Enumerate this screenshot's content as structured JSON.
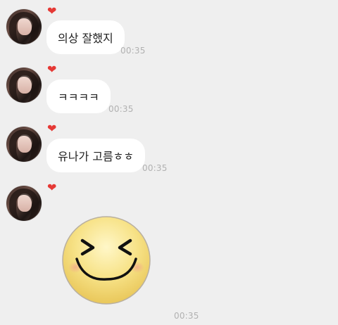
{
  "messages": [
    {
      "text": "의상 잘했지",
      "time": "00:35"
    },
    {
      "text": "ㅋㅋㅋㅋ",
      "time": "00:35"
    },
    {
      "text": "유나가 고름ㅎㅎ",
      "time": "00:35"
    },
    {
      "sticker": "smiling-laughing-emoji",
      "time": "00:35"
    }
  ],
  "reaction_icon": "heart-icon",
  "colors": {
    "background": "#efefef",
    "bubble": "#ffffff",
    "text": "#222222",
    "timestamp": "#b1b1b1",
    "heart": "#e53935",
    "emoji_face": "#f7d86a"
  }
}
